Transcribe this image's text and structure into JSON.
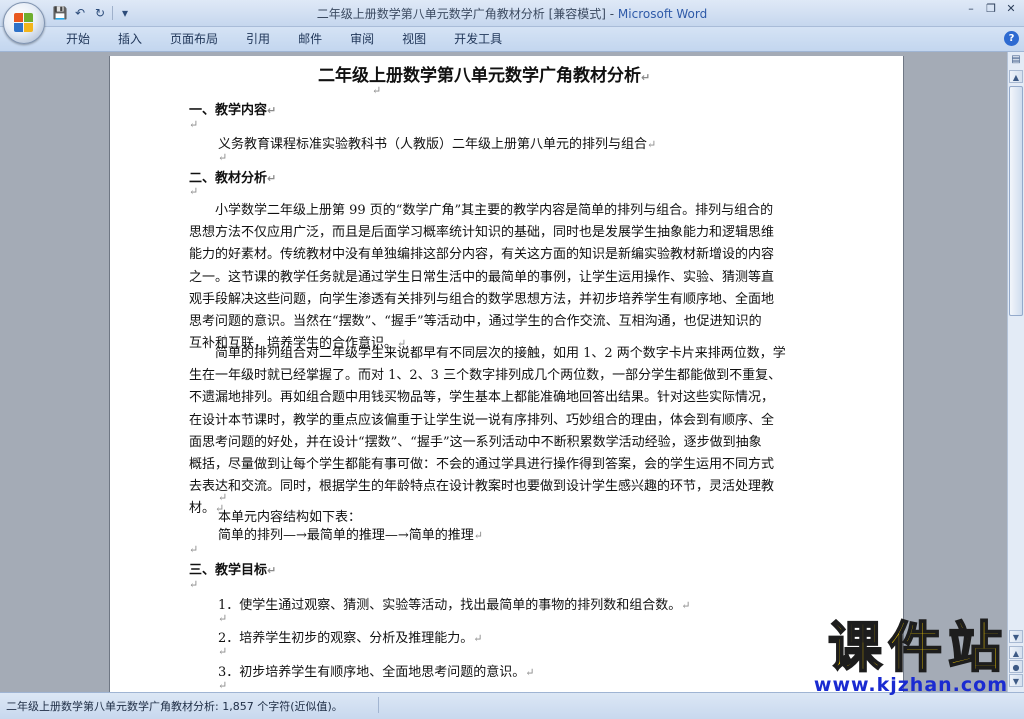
{
  "window": {
    "title_doc": "二年级上册数学第八单元数学广角教材分析 [兼容模式] - ",
    "title_app": "Microsoft Word"
  },
  "qat": {
    "save_icon": "💾",
    "undo_icon": "↶",
    "redo_icon": "↻",
    "more_icon": "▾"
  },
  "ribbon": {
    "tabs": [
      {
        "label": "开始"
      },
      {
        "label": "插入"
      },
      {
        "label": "页面布局"
      },
      {
        "label": "引用"
      },
      {
        "label": "邮件"
      },
      {
        "label": "审阅"
      },
      {
        "label": "视图"
      },
      {
        "label": "开发工具"
      }
    ],
    "help": "?"
  },
  "document": {
    "title": "二年级上册数学第八单元数学广角教材分析",
    "pm": "↵",
    "h1": "一、教学内容",
    "p1": "义务教育课程标准实验教科书（人教版）二年级上册第八单元的排列与组合",
    "h2": "二、教材分析",
    "p2_lines": [
      "　　小学数学二年级上册第 99 页的“数学广角”其主要的教学内容是简单的排列与组合。排列与组合的",
      "思想方法不仅应用广泛，而且是后面学习概率统计知识的基础，同时也是发展学生抽象能力和逻辑思维",
      "能力的好素材。传统教材中没有单独编排这部分内容，有关这方面的知识是新编实验教材新增设的内容",
      "之一。这节课的教学任务就是通过学生日常生活中的最简单的事例，让学生运用操作、实验、猜测等直",
      "观手段解决这些问题，向学生渗透有关排列与组合的数学思想方法，并初步培养学生有顺序地、全面地",
      "思考问题的意识。当然在“摆数”、“握手”等活动中，通过学生的合作交流、互相沟通，也促进知识的",
      "互补和互联，培养学生的合作意识。"
    ],
    "p3_lines": [
      "　　简单的排列组合对二年级学生来说都早有不同层次的接触，如用 1、2 两个数字卡片来排两位数，学",
      "生在一年级时就已经掌握了。而对 1、2、3 三个数字排列成几个两位数，一部分学生都能做到不重复、",
      "不遗漏地排列。再如组合题中用钱买物品等，学生基本上都能准确地回答出结果。针对这些实际情况，",
      "在设计本节课时，教学的重点应该偏重于让学生说一说有序排列、巧妙组合的理由，体会到有顺序、全",
      "面思考问题的好处，并在设计“摆数”、“握手”这一系列活动中不断积累数学活动经验，逐步做到抽象",
      "概括，尽量做到让每个学生都能有事可做：不会的通过学具进行操作得到答案，会的学生运用不同方式",
      "去表达和交流。同时，根据学生的年龄特点在设计教案时也要做到设计学生感兴趣的环节，灵活处理教",
      "材。"
    ],
    "p4": "本单元内容结构如下表：",
    "p5": "简单的排列—→最简单的推理—→简单的推理",
    "h3": "三、教学目标",
    "goal1": "1．使学生通过观察、猜测、实验等活动，找出最简单的事物的排列数和组合数。",
    "goal2": "2．培养学生初步的观察、分析及推理能力。",
    "goal3": "3．初步培养学生有顺序地、全面地思考问题的意识。"
  },
  "status": {
    "text": "二年级上册数学第八单元数学广角教材分析: 1,857 个字符(近似值)。"
  },
  "watermark": {
    "brand": "课件站",
    "url": "www.kjzhan.com"
  }
}
